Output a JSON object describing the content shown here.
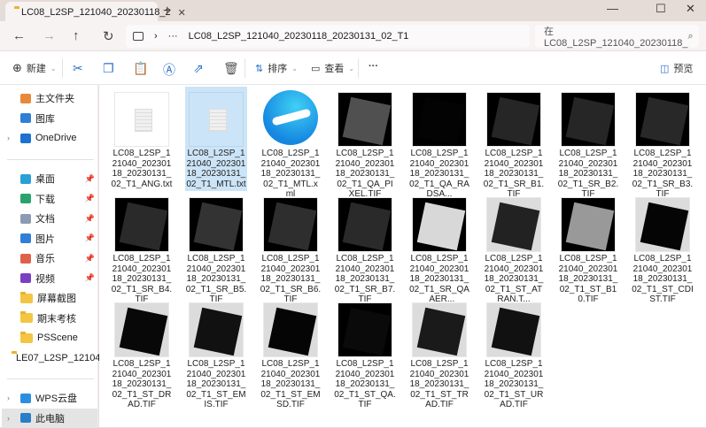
{
  "tab": {
    "title": "LC08_L2SP_121040_20230118_2",
    "close": "✕",
    "new": "+"
  },
  "window": {
    "minimize": "—",
    "maximize": "☐",
    "close": "✕"
  },
  "nav": {
    "back": "←",
    "forward": "→",
    "up": "↑",
    "refresh": "↻",
    "breadcrumb_sep": "›",
    "ellipsis": "···",
    "path": "LC08_L2SP_121040_20230118_20230131_02_T1",
    "search_placeholder": "在 LC08_L2SP_121040_20230118_",
    "search_icon": "⌕"
  },
  "toolbar": {
    "new": "新建",
    "sort": "排序",
    "view": "查看",
    "more": "···",
    "preview": "预览"
  },
  "sidebar": {
    "quick": [
      {
        "label": "主文件夹",
        "color": "#e8883a"
      },
      {
        "label": "图库",
        "color": "#2f7fd6"
      },
      {
        "label": "OneDrive",
        "color": "#1d72d0"
      }
    ],
    "pinned": [
      {
        "label": "桌面",
        "color": "#2aa0d8"
      },
      {
        "label": "下载",
        "color": "#29a36b"
      },
      {
        "label": "文档",
        "color": "#8a9bb3"
      },
      {
        "label": "图片",
        "color": "#2f7fd6"
      },
      {
        "label": "音乐",
        "color": "#e0604a"
      },
      {
        "label": "视频",
        "color": "#7b3fc4"
      }
    ],
    "folders": [
      {
        "label": "屏幕截图"
      },
      {
        "label": "期末考核"
      },
      {
        "label": "PSScene"
      },
      {
        "label": "LE07_L2SP_12104"
      }
    ],
    "bottom": [
      {
        "label": "WPS云盘",
        "color": "#2b8fe0"
      },
      {
        "label": "此电脑",
        "color": "#2a7dc7"
      }
    ]
  },
  "files": [
    {
      "name": "LC08_L2SP_121040_20230118_20230131_02_T1_ANG.txt",
      "type": "doc"
    },
    {
      "name": "LC08_L2SP_121040_20230118_20230131_02_T1_MTL.txt",
      "type": "doc",
      "selected": true
    },
    {
      "name": "LC08_L2SP_121040_20230118_20230131_02_T1_MTL.xml",
      "type": "edge"
    },
    {
      "name": "LC08_L2SP_121040_20230118_20230131_02_T1_QA_PIXEL.TIF",
      "type": "img",
      "bg": "#000000",
      "fg": "#505050"
    },
    {
      "name": "LC08_L2SP_121040_20230118_20230131_02_T1_QA_RADSA...",
      "type": "img",
      "bg": "#000000",
      "fg": "#030303"
    },
    {
      "name": "LC08_L2SP_121040_20230118_20230131_02_T1_SR_B1.TIF",
      "type": "img",
      "bg": "#000000",
      "fg": "#262626"
    },
    {
      "name": "LC08_L2SP_121040_20230118_20230131_02_T1_SR_B2.TIF",
      "type": "img",
      "bg": "#000000",
      "fg": "#262626"
    },
    {
      "name": "LC08_L2SP_121040_20230118_20230131_02_T1_SR_B3.TIF",
      "type": "img",
      "bg": "#000000",
      "fg": "#282828"
    },
    {
      "name": "LC08_L2SP_121040_20230118_20230131_02_T1_SR_B4.TIF",
      "type": "img",
      "bg": "#000000",
      "fg": "#2a2a2a"
    },
    {
      "name": "LC08_L2SP_121040_20230118_20230131_02_T1_SR_B5.TIF",
      "type": "img",
      "bg": "#000000",
      "fg": "#333333"
    },
    {
      "name": "LC08_L2SP_121040_20230118_20230131_02_T1_SR_B6.TIF",
      "type": "img",
      "bg": "#000000",
      "fg": "#2e2e2e"
    },
    {
      "name": "LC08_L2SP_121040_20230118_20230131_02_T1_SR_B7.TIF",
      "type": "img",
      "bg": "#000000",
      "fg": "#2a2a2a"
    },
    {
      "name": "LC08_L2SP_121040_20230118_20230131_02_T1_SR_QA_AER...",
      "type": "img",
      "bg": "#000000",
      "fg": "#d8d8d8"
    },
    {
      "name": "LC08_L2SP_121040_20230118_20230131_02_T1_ST_ATRAN.T...",
      "type": "img",
      "bg": "#dcdcdc",
      "fg": "#222222"
    },
    {
      "name": "LC08_L2SP_121040_20230118_20230131_02_T1_ST_B10.TIF",
      "type": "img",
      "bg": "#000000",
      "fg": "#999999"
    },
    {
      "name": "LC08_L2SP_121040_20230118_20230131_02_T1_ST_CDIST.TIF",
      "type": "img",
      "bg": "#dcdcdc",
      "fg": "#050505"
    },
    {
      "name": "LC08_L2SP_121040_20230118_20230131_02_T1_ST_DRAD.TIF",
      "type": "img",
      "bg": "#dcdcdc",
      "fg": "#080808"
    },
    {
      "name": "LC08_L2SP_121040_20230118_20230131_02_T1_ST_EMIS.TIF",
      "type": "img",
      "bg": "#dcdcdc",
      "fg": "#111111"
    },
    {
      "name": "LC08_L2SP_121040_20230118_20230131_02_T1_ST_EMSD.TIF",
      "type": "img",
      "bg": "#dcdcdc",
      "fg": "#050505"
    },
    {
      "name": "LC08_L2SP_121040_20230118_20230131_02_T1_ST_QA.TIF",
      "type": "img",
      "bg": "#000000",
      "fg": "#0a0a0a"
    },
    {
      "name": "LC08_L2SP_121040_20230118_20230131_02_T1_ST_TRAD.TIF",
      "type": "img",
      "bg": "#dcdcdc",
      "fg": "#1a1a1a"
    },
    {
      "name": "LC08_L2SP_121040_20230118_20230131_02_T1_ST_URAD.TIF",
      "type": "img",
      "bg": "#dcdcdc",
      "fg": "#111111"
    }
  ]
}
